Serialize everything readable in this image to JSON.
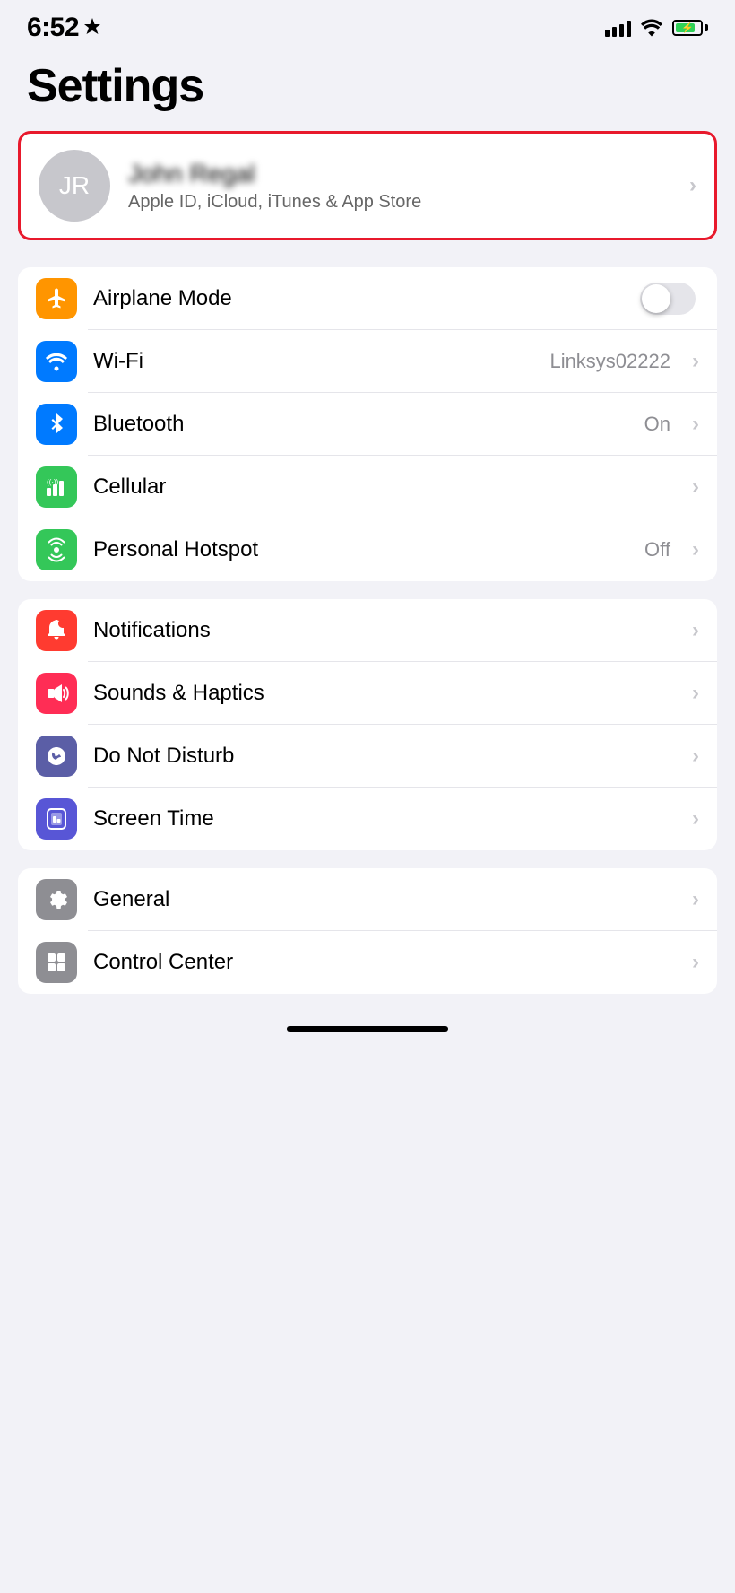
{
  "statusBar": {
    "time": "6:52",
    "locationIcon": "◁",
    "batteryCharging": true
  },
  "pageTitle": "Settings",
  "profile": {
    "initials": "JR",
    "name": "John Regal",
    "subtitle": "Apple ID, iCloud, iTunes & App Store"
  },
  "group1": [
    {
      "id": "airplane-mode",
      "label": "Airplane Mode",
      "iconBg": "icon-orange",
      "iconType": "airplane",
      "rightType": "toggle",
      "toggleOn": false
    },
    {
      "id": "wifi",
      "label": "Wi-Fi",
      "iconBg": "icon-blue",
      "iconType": "wifi",
      "rightType": "value-chevron",
      "value": "Linksys02222"
    },
    {
      "id": "bluetooth",
      "label": "Bluetooth",
      "iconBg": "icon-blue-dark",
      "iconType": "bluetooth",
      "rightType": "value-chevron",
      "value": "On"
    },
    {
      "id": "cellular",
      "label": "Cellular",
      "iconBg": "icon-green",
      "iconType": "cellular",
      "rightType": "chevron",
      "value": ""
    },
    {
      "id": "personal-hotspot",
      "label": "Personal Hotspot",
      "iconBg": "icon-green2",
      "iconType": "hotspot",
      "rightType": "value-chevron",
      "value": "Off"
    }
  ],
  "group2": [
    {
      "id": "notifications",
      "label": "Notifications",
      "iconBg": "icon-red",
      "iconType": "notifications",
      "rightType": "chevron"
    },
    {
      "id": "sounds-haptics",
      "label": "Sounds & Haptics",
      "iconBg": "icon-pink",
      "iconType": "sounds",
      "rightType": "chevron"
    },
    {
      "id": "do-not-disturb",
      "label": "Do Not Disturb",
      "iconBg": "icon-indigo",
      "iconType": "moon",
      "rightType": "chevron"
    },
    {
      "id": "screen-time",
      "label": "Screen Time",
      "iconBg": "icon-purple",
      "iconType": "screentime",
      "rightType": "chevron"
    }
  ],
  "group3": [
    {
      "id": "general",
      "label": "General",
      "iconBg": "icon-gray",
      "iconType": "gear",
      "rightType": "chevron"
    },
    {
      "id": "control-center",
      "label": "Control Center",
      "iconBg": "icon-gray",
      "iconType": "toggles",
      "rightType": "chevron"
    }
  ]
}
